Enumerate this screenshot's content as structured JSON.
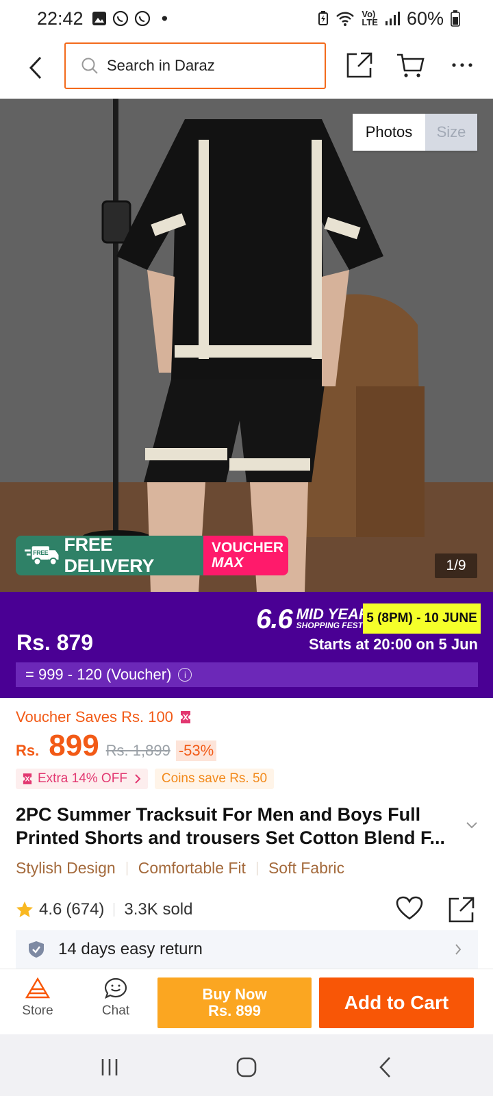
{
  "status_bar": {
    "time": "22:42",
    "dot": "•",
    "volte_top": "Vo)",
    "volte_bottom": "LTE",
    "battery": "60%"
  },
  "top_bar": {
    "search_placeholder": "Search in Daraz"
  },
  "gallery": {
    "tab_photos": "Photos",
    "tab_size": "Size",
    "counter": "1/9",
    "promo_free_badge": "FREE",
    "promo_free": "FREE DELIVERY",
    "promo_voucher_1": "VOUCHER",
    "promo_voucher_2": "MAX"
  },
  "campaign": {
    "price": "Rs. 879",
    "logo_number": "6.6",
    "logo_line1": "MID YEAR",
    "logo_line2": "SHOPPING FEST!",
    "dates": "5 (8PM) - 10 JUNE",
    "starts": "Starts at 20:00 on 5 Jun",
    "formula": "= 999 - 120 (Voucher)",
    "info_glyph": "i"
  },
  "pricing": {
    "voucher_saves": "Voucher Saves Rs. 100",
    "currency": "Rs.",
    "price": "899",
    "original_price": "Rs. 1,899",
    "discount": "-53%",
    "chip_extra": "Extra 14% OFF",
    "chip_coins": "Coins save Rs. 50"
  },
  "product": {
    "title": "2PC Summer Tracksuit For Men and Boys Full Printed Shorts and trousers Set Cotton Blend F...",
    "features": [
      "Stylish Design",
      "Comfortable Fit",
      "Soft Fabric"
    ],
    "rating": "4.6",
    "reviews": "(674)",
    "sold": "3.3K sold",
    "return_policy": "14 days easy return"
  },
  "actions": {
    "store": "Store",
    "chat": "Chat",
    "buy_now_line1": "Buy Now",
    "buy_now_line2": "Rs. 899",
    "add_to_cart": "Add to Cart"
  },
  "colors": {
    "brand_orange": "#f85606",
    "buy_now": "#fba621",
    "campaign_purple": "#4a0094",
    "free_delivery_green": "#2f8167",
    "voucher_pink": "#ff1a6b"
  }
}
